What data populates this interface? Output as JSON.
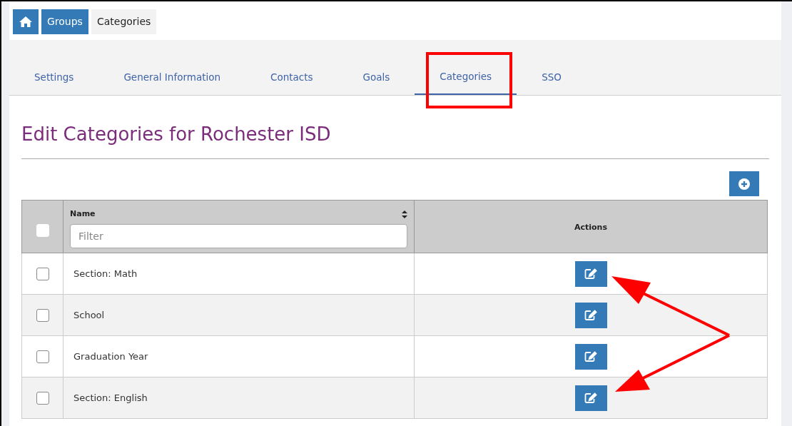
{
  "breadcrumb": [
    {
      "label": "Groups",
      "selected": false
    },
    {
      "label": "Categories",
      "selected": true
    }
  ],
  "tabs": [
    {
      "label": "Settings",
      "selected": false
    },
    {
      "label": "General Information",
      "selected": false
    },
    {
      "label": "Contacts",
      "selected": false
    },
    {
      "label": "Goals",
      "selected": false
    },
    {
      "label": "Categories",
      "selected": true
    },
    {
      "label": "SSO",
      "selected": false
    }
  ],
  "heading": "Edit Categories for Rochester ISD",
  "table": {
    "select_all_checked": false,
    "name_column": "Name",
    "filter_placeholder": "Filter",
    "actions_column": "Actions",
    "rows": [
      {
        "name": "Section: Math",
        "checked": false
      },
      {
        "name": "School",
        "checked": false
      },
      {
        "name": "Graduation Year",
        "checked": false
      },
      {
        "name": "Section: English",
        "checked": false
      }
    ]
  }
}
